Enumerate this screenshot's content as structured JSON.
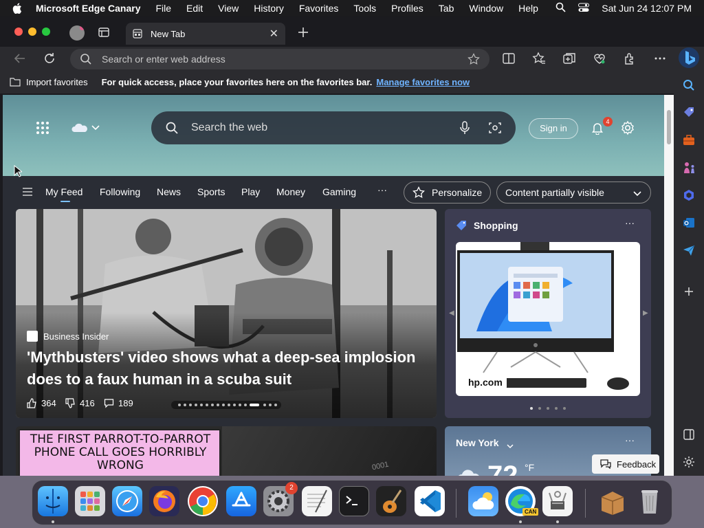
{
  "menubar": {
    "app_name": "Microsoft Edge Canary",
    "items": [
      "File",
      "Edit",
      "View",
      "History",
      "Favorites",
      "Tools",
      "Profiles",
      "Tab",
      "Window",
      "Help"
    ],
    "clock": "Sat Jun 24  12:07 PM"
  },
  "tabs": [
    {
      "title": "New Tab"
    }
  ],
  "addressbar": {
    "placeholder": "Search or enter web address"
  },
  "favorites_bar": {
    "import_label": "Import favorites",
    "hint": "For quick access, place your favorites here on the favorites bar.",
    "manage_link": "Manage favorites now"
  },
  "newtab": {
    "search_placeholder": "Search the web",
    "signin_label": "Sign in",
    "notification_count": "4"
  },
  "feed_nav": {
    "tabs": [
      "My Feed",
      "Following",
      "News",
      "Sports",
      "Play",
      "Money",
      "Gaming"
    ],
    "more": "···",
    "personalize_label": "Personalize",
    "visibility_label": "Content partially visible"
  },
  "hero": {
    "source": "Business Insider",
    "title": "'Mythbusters' video shows what a deep-sea implosion does to a faux human in a scuba suit",
    "likes": "364",
    "dislikes": "416",
    "comments": "189"
  },
  "shopping": {
    "title": "Shopping",
    "more": "···",
    "domain": "hp.com"
  },
  "comic": {
    "text": "THE FIRST PARROT-TO-PARROT PHONE CALL GOES HORRIBLY WRONG",
    "serial": "0001"
  },
  "weather": {
    "city": "New York",
    "temp": "72",
    "unit": "°F",
    "more": "···"
  },
  "feedback_label": "Feedback",
  "dock": {
    "settings_badge": "2",
    "edge_canary_badge": "CAN"
  },
  "colors": {
    "accent": "#7cc1ff",
    "link": "#6fb3ff",
    "notification": "#e0432f",
    "hero_band": "#7bb0b2"
  }
}
